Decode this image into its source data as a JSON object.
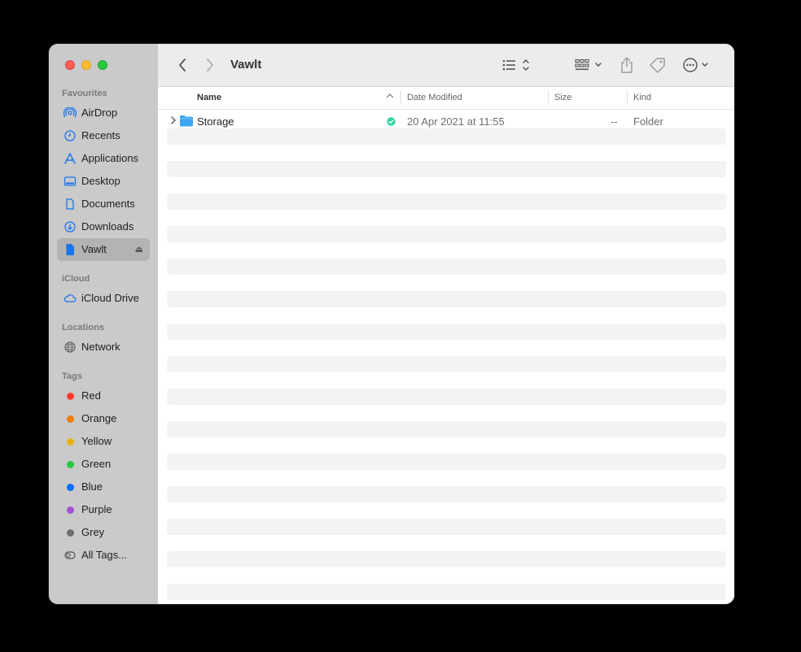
{
  "window": {
    "title": "Vawlt"
  },
  "sidebar": {
    "sections": {
      "favourites": "Favourites",
      "icloud": "iCloud",
      "locations": "Locations",
      "tags": "Tags"
    },
    "favourites": [
      {
        "label": "AirDrop",
        "icon": "airdrop-icon"
      },
      {
        "label": "Recents",
        "icon": "clock-icon"
      },
      {
        "label": "Applications",
        "icon": "applications-icon"
      },
      {
        "label": "Desktop",
        "icon": "desktop-icon"
      },
      {
        "label": "Documents",
        "icon": "document-icon"
      },
      {
        "label": "Downloads",
        "icon": "download-icon"
      },
      {
        "label": "Vawlt",
        "icon": "file-icon",
        "selected": true
      }
    ],
    "icloud": [
      {
        "label": "iCloud Drive",
        "icon": "cloud-icon"
      }
    ],
    "locations": [
      {
        "label": "Network",
        "icon": "globe-icon"
      }
    ],
    "tags": [
      {
        "label": "Red",
        "color": "#ff3b30"
      },
      {
        "label": "Orange",
        "color": "#f07c0c"
      },
      {
        "label": "Yellow",
        "color": "#e8b10f"
      },
      {
        "label": "Green",
        "color": "#28c840"
      },
      {
        "label": "Blue",
        "color": "#0a6cff"
      },
      {
        "label": "Purple",
        "color": "#a550d6"
      },
      {
        "label": "Grey",
        "color": "#6e6e6e"
      },
      {
        "label": "All Tags...",
        "icon": "all-tags-icon"
      }
    ]
  },
  "columns": {
    "name": "Name",
    "date": "Date Modified",
    "size": "Size",
    "kind": "Kind"
  },
  "files": [
    {
      "name": "Storage",
      "date": "20 Apr 2021 at 11:55",
      "size": "--",
      "kind": "Folder",
      "status": "synced"
    }
  ],
  "colors": {
    "accent": "#1a73e8",
    "sync_status": "#2ed3a6",
    "folder": "#3aa5f0"
  }
}
